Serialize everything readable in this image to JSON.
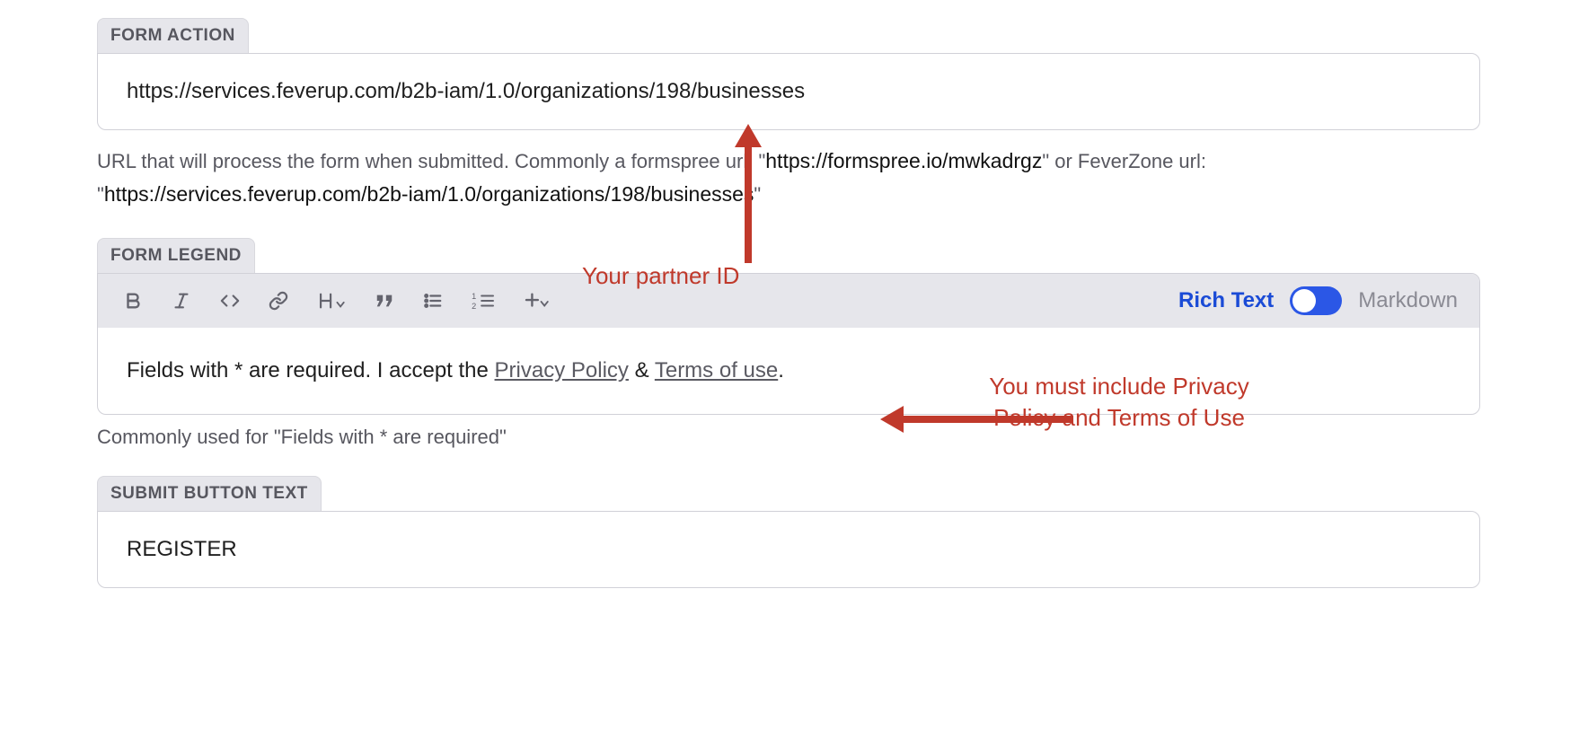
{
  "formAction": {
    "label": "FORM ACTION",
    "value": "https://services.feverup.com/b2b-iam/1.0/organizations/198/businesses",
    "help_prefix": "URL that will process the form when submitted. Commonly a formspree url: ",
    "help_url1": "https://formspree.io/mwkadrgz",
    "help_mid": " or FeverZone url: ",
    "help_url2": "https://services.feverup.com/b2b-iam/1.0/organizations/198/businesses"
  },
  "formLegend": {
    "label": "FORM LEGEND",
    "body_prefix": "Fields with * are required. I accept the ",
    "link1": "Privacy Policy",
    "body_mid": " & ",
    "link2": "Terms of use",
    "body_suffix": ".",
    "help": "Commonly used for \"Fields with * are required\"",
    "mode_rich": "Rich Text",
    "mode_md": "Markdown"
  },
  "submitButtonText": {
    "label": "SUBMIT BUTTON TEXT",
    "value": "REGISTER"
  },
  "annotations": {
    "partner_id": "Your partner ID",
    "must_include": "You must include Privacy Policy and Terms of Use"
  }
}
